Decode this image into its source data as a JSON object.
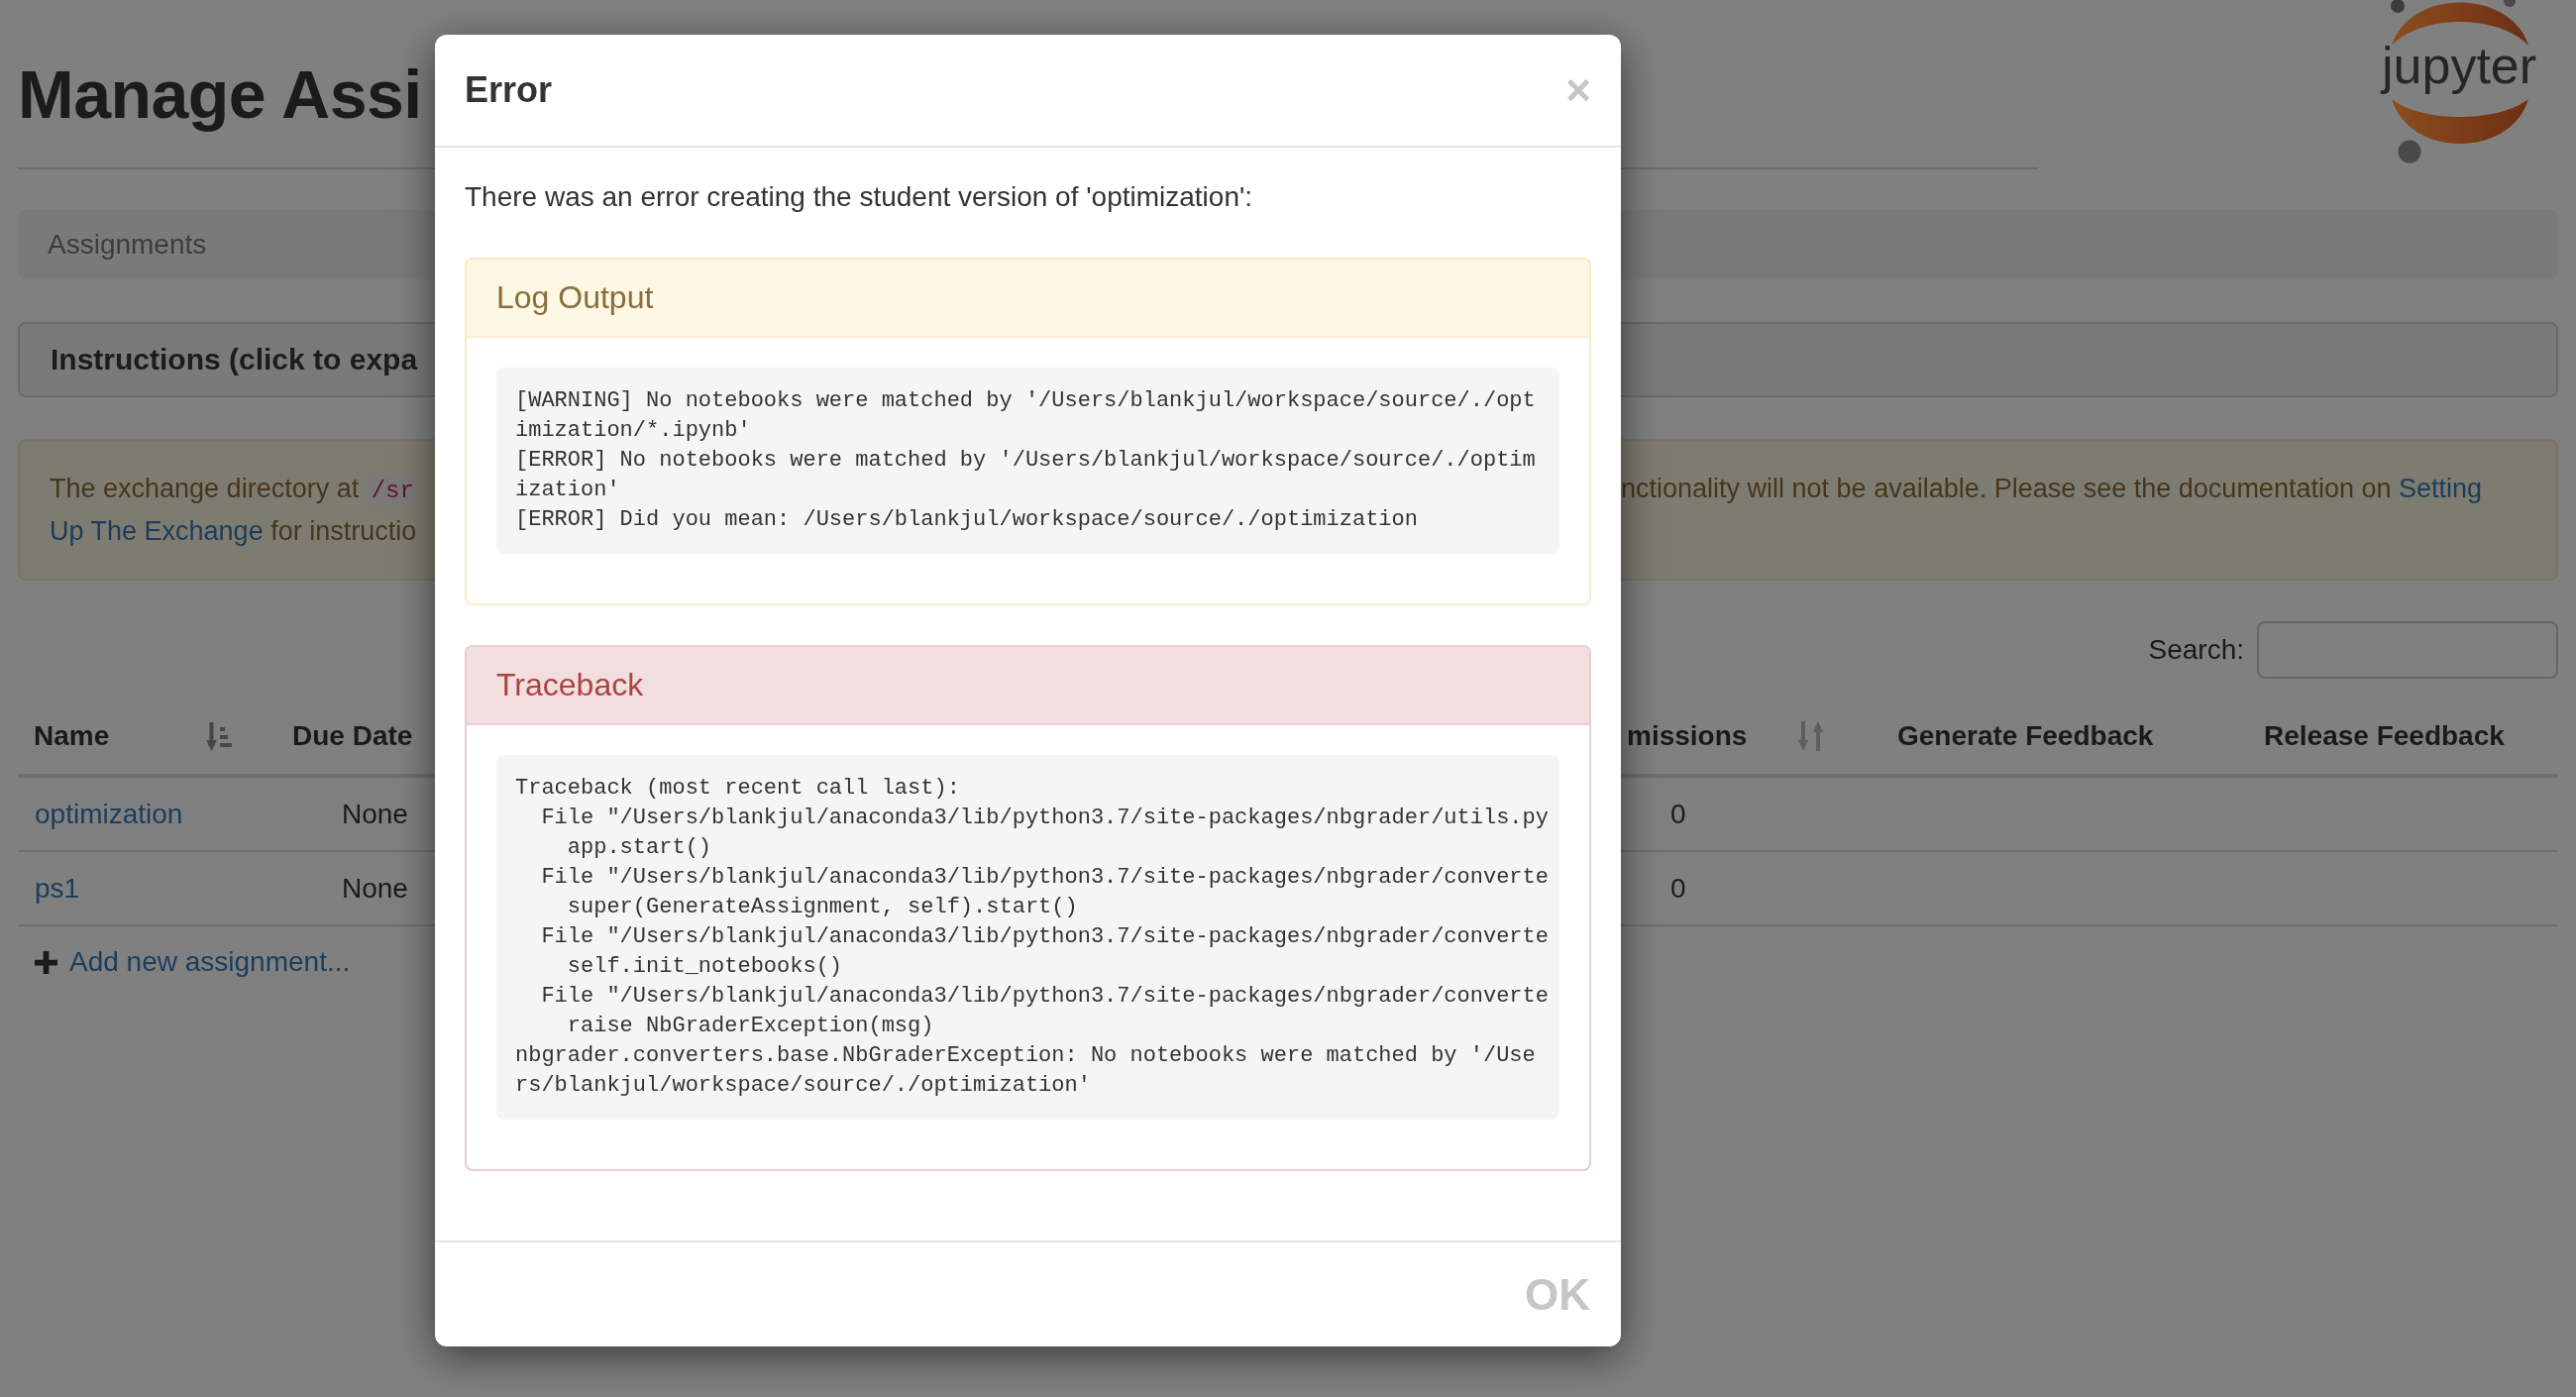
{
  "header": {
    "title": "Manage Assi",
    "logo_text": "jupyter"
  },
  "breadcrumb": {
    "items": [
      {
        "label": "Assignments"
      }
    ]
  },
  "instructions_panel": {
    "title": "Instructions (click to expa"
  },
  "alert": {
    "left_lines": [
      [
        {
          "kind": "text",
          "text": "The exchange directory at"
        },
        {
          "kind": "code",
          "text": "/sr"
        }
      ],
      [
        {
          "kind": "link",
          "text": "Up The Exchange"
        },
        {
          "kind": "text",
          "text": "for instructio"
        }
      ]
    ],
    "right_lines": [
      [
        {
          "kind": "text",
          "text": "nctionality will not be available. Please see the documentation on"
        },
        {
          "kind": "link",
          "text": "Setting"
        }
      ]
    ]
  },
  "search": {
    "label": "Search:"
  },
  "table": {
    "columns_left": [
      {
        "label": "Name",
        "sorted": true
      },
      {
        "label": "Due Date"
      }
    ],
    "columns_right": [
      {
        "label": "missions",
        "sorted": false
      },
      {
        "label": "Generate Feedback"
      },
      {
        "label": "Release Feedback"
      }
    ],
    "rows": [
      {
        "left_cells": [
          "optimization",
          "None"
        ],
        "right_cells": [
          "0"
        ]
      },
      {
        "left_cells": [
          "ps1",
          "None"
        ],
        "right_cells": [
          "0"
        ]
      }
    ]
  },
  "add_assignment": {
    "label": "Add new assignment..."
  },
  "dialog": {
    "title": "Error",
    "close_label": "×",
    "message": "There was an error creating the student version of 'optimization':",
    "panels": [
      {
        "kind": "warning",
        "title": "Log Output",
        "lines": [
          "[WARNING] No notebooks were matched by '/Users/blankjul/workspace/source/./opt",
          "imization/*.ipynb'",
          "[ERROR] No notebooks were matched by '/Users/blankjul/workspace/source/./optim",
          "ization'",
          "[ERROR] Did you mean: /Users/blankjul/workspace/source/./optimization"
        ]
      },
      {
        "kind": "danger",
        "title": "Traceback",
        "lines": [
          "Traceback (most recent call last):",
          "  File \"/Users/blankjul/anaconda3/lib/python3.7/site-packages/nbgrader/utils.py",
          "    app.start()",
          "  File \"/Users/blankjul/anaconda3/lib/python3.7/site-packages/nbgrader/converte",
          "    super(GenerateAssignment, self).start()",
          "  File \"/Users/blankjul/anaconda3/lib/python3.7/site-packages/nbgrader/converte",
          "    self.init_notebooks()",
          "  File \"/Users/blankjul/anaconda3/lib/python3.7/site-packages/nbgrader/converte",
          "    raise NbGraderException(msg)",
          "nbgrader.converters.base.NbGraderException: No notebooks were matched by '/Use",
          "rs/blankjul/workspace/source/./optimization'"
        ]
      }
    ],
    "buttons": [
      {
        "label": "OK"
      }
    ]
  }
}
